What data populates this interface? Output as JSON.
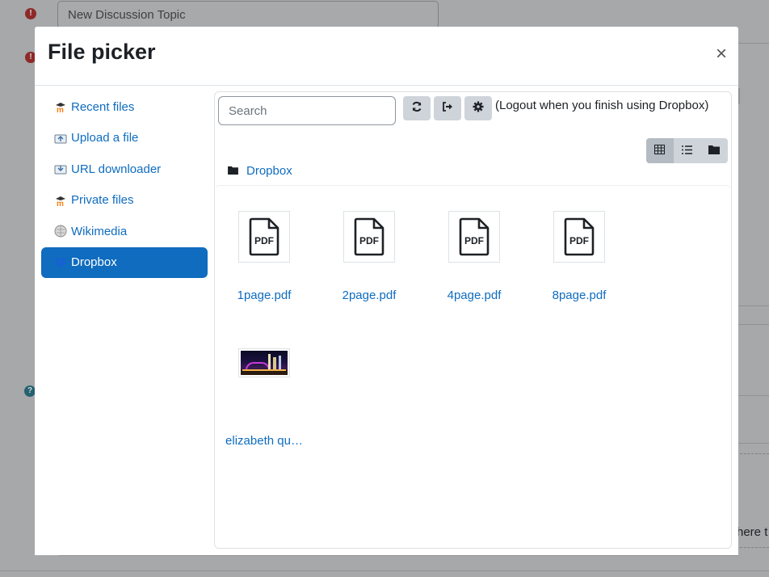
{
  "background": {
    "subject_value": "New Discussion Topic",
    "partial_text": "here t"
  },
  "modal": {
    "title": "File picker",
    "close_label": "×"
  },
  "repositories": [
    {
      "label": "Recent files",
      "icon": "moodle-icon"
    },
    {
      "label": "Upload a file",
      "icon": "upload-icon"
    },
    {
      "label": "URL downloader",
      "icon": "url-download-icon"
    },
    {
      "label": "Private files",
      "icon": "moodle-icon"
    },
    {
      "label": "Wikimedia",
      "icon": "wikimedia-icon"
    },
    {
      "label": "Dropbox",
      "icon": "dropbox-icon",
      "active": true
    }
  ],
  "toolbar": {
    "search_placeholder": "Search",
    "refresh_icon": "refresh-icon",
    "logout_icon": "logout-icon",
    "settings_icon": "gear-icon",
    "logout_note": "(Logout when you finish using Dropbox)"
  },
  "view_modes": [
    {
      "icon": "grid-icon",
      "active": true
    },
    {
      "icon": "list-icon",
      "active": false
    },
    {
      "icon": "tree-folder-icon",
      "active": false
    }
  ],
  "path": {
    "folder_icon": "folder-icon",
    "label": "Dropbox"
  },
  "files": [
    {
      "name": "1page.pdf",
      "type": "pdf"
    },
    {
      "name": "2page.pdf",
      "type": "pdf"
    },
    {
      "name": "4page.pdf",
      "type": "pdf"
    },
    {
      "name": "8page.pdf",
      "type": "pdf"
    },
    {
      "name": "elizabeth qu…",
      "type": "image"
    }
  ],
  "colors": {
    "accent": "#0f6cbf",
    "button_gray": "#ced4da",
    "overlay": "#a6a8aa"
  }
}
